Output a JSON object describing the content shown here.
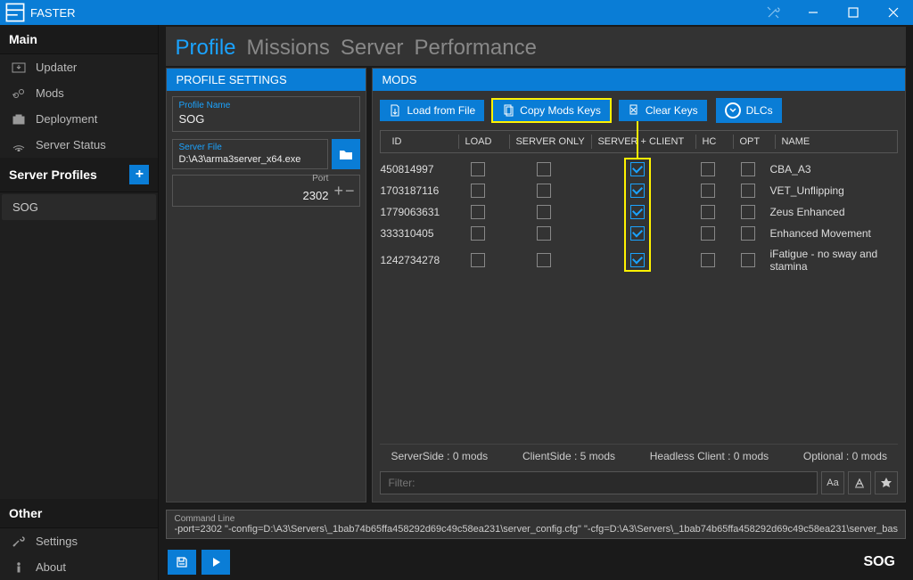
{
  "app": {
    "title": "FASTER"
  },
  "sidebar": {
    "main_label": "Main",
    "items": [
      {
        "label": "Updater"
      },
      {
        "label": "Mods"
      },
      {
        "label": "Deployment"
      },
      {
        "label": "Server Status"
      }
    ],
    "profiles_label": "Server Profiles",
    "profiles": [
      {
        "label": "SOG"
      }
    ],
    "other_label": "Other",
    "other": [
      {
        "label": "Settings"
      },
      {
        "label": "About"
      }
    ]
  },
  "tabs": {
    "profile": "Profile",
    "missions": "Missions",
    "server": "Server",
    "performance": "Performance"
  },
  "profile_settings": {
    "header": "PROFILE SETTINGS",
    "name_label": "Profile Name",
    "name_value": "SOG",
    "server_file_label": "Server File",
    "server_file_value": "D:\\A3\\arma3server_x64.exe",
    "port_label": "Port",
    "port_value": "2302"
  },
  "mods": {
    "header": "MODS",
    "buttons": {
      "load": "Load from File",
      "copy": "Copy Mods Keys",
      "clear": "Clear Keys",
      "dlcs": "DLCs"
    },
    "columns": {
      "id": "ID",
      "load": "LOAD",
      "server_only": "SERVER ONLY",
      "server_client": "SERVER + CLIENT",
      "hc": "HC",
      "opt": "OPT",
      "name": "NAME"
    },
    "rows": [
      {
        "id": "450814997",
        "load": false,
        "server_only": false,
        "server_client": true,
        "hc": false,
        "opt": false,
        "name": "CBA_A3"
      },
      {
        "id": "1703187116",
        "load": false,
        "server_only": false,
        "server_client": true,
        "hc": false,
        "opt": false,
        "name": "VET_Unflipping"
      },
      {
        "id": "1779063631",
        "load": false,
        "server_only": false,
        "server_client": true,
        "hc": false,
        "opt": false,
        "name": "Zeus Enhanced"
      },
      {
        "id": "333310405",
        "load": false,
        "server_only": false,
        "server_client": true,
        "hc": false,
        "opt": false,
        "name": "Enhanced Movement"
      },
      {
        "id": "1242734278",
        "load": false,
        "server_only": false,
        "server_client": true,
        "hc": false,
        "opt": false,
        "name": "iFatigue - no sway and stamina"
      }
    ],
    "stats": {
      "server": "ServerSide : 0 mods",
      "client": "ClientSide : 5 mods",
      "hc": "Headless Client : 0 mods",
      "opt": "Optional : 0 mods"
    },
    "filter_placeholder": "Filter:"
  },
  "command_line": {
    "label": "Command Line",
    "value": "-port=2302 \"-config=D:\\A3\\Servers\\_1bab74b65ffa458292d69c49c58ea231\\server_config.cfg\" \"-cfg=D:\\A3\\Servers\\_1bab74b65ffa458292d69c49c58ea231\\server_bas"
  },
  "bottom": {
    "profile_name": "SOG"
  }
}
